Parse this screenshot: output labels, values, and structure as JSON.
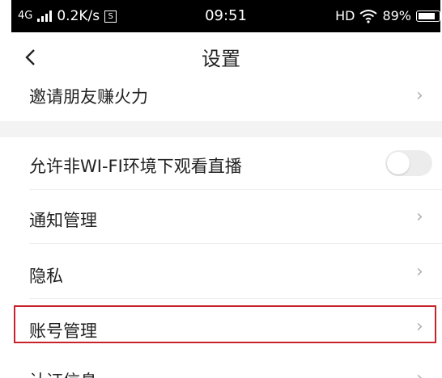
{
  "status_bar": {
    "network": "4G",
    "speed": "0.2K/s",
    "s_icon_text": "S",
    "time": "09:51",
    "hd": "HD",
    "battery": "89%",
    "battery_level": 0.89
  },
  "header": {
    "title": "设置"
  },
  "settings": {
    "invite": "邀请朋友赚火力",
    "wifi_live": "允许非WI-FI环境下观看直播",
    "wifi_live_enabled": false,
    "notifications": "通知管理",
    "privacy": "隐私",
    "account": "账号管理",
    "next_partial": "认证信息"
  },
  "colors": {
    "highlight": "#c8222c",
    "toggle_off": "#ececec"
  }
}
